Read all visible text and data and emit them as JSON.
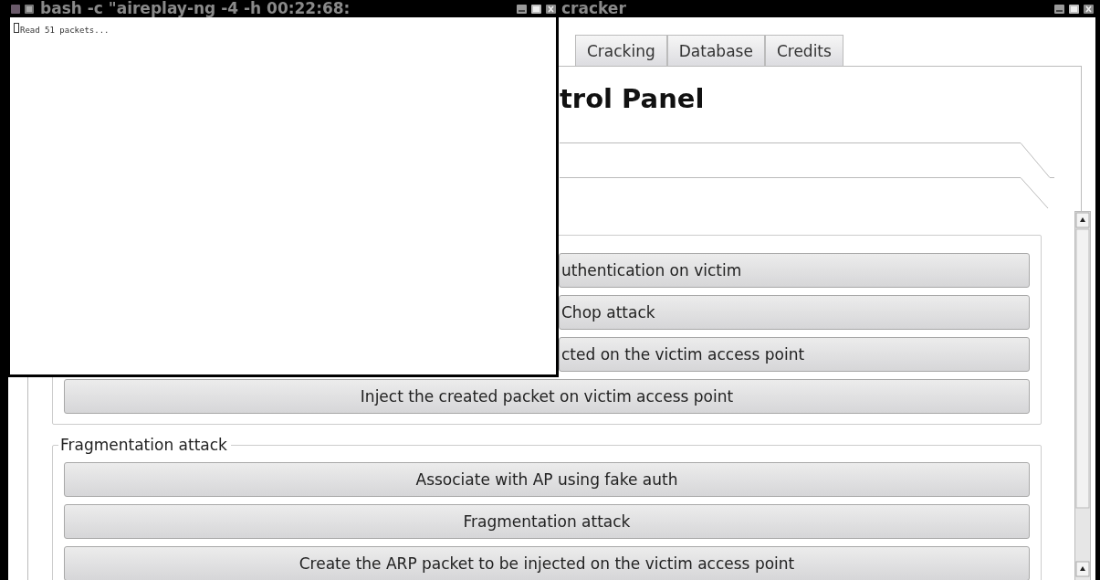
{
  "terminal_window": {
    "title": "bash -c \"aireplay-ng -4 -h 00:22:68:",
    "output": "Read 51 packets..."
  },
  "main_window": {
    "title": "cracker"
  },
  "tabs": [
    {
      "label": "Cracking",
      "selected": false
    },
    {
      "label": "Database",
      "selected": false
    },
    {
      "label": "Credits",
      "selected": false
    }
  ],
  "heading": "trol Panel",
  "groups": [
    {
      "buttons": [
        {
          "label": "uthentication on victim",
          "kind": "partial"
        },
        {
          "label": "Chop attack",
          "kind": "partial"
        },
        {
          "label": "cted on the victim access point",
          "kind": "partial"
        },
        {
          "label": "Inject the created packet on victim access point",
          "kind": "full"
        }
      ]
    },
    {
      "label": "Fragmentation attack",
      "buttons": [
        {
          "label": "Associate with AP using fake auth",
          "kind": "full"
        },
        {
          "label": "Fragmentation attack",
          "kind": "full"
        },
        {
          "label": "Create the ARP packet to be injected on the victim access point",
          "kind": "full"
        }
      ]
    }
  ]
}
